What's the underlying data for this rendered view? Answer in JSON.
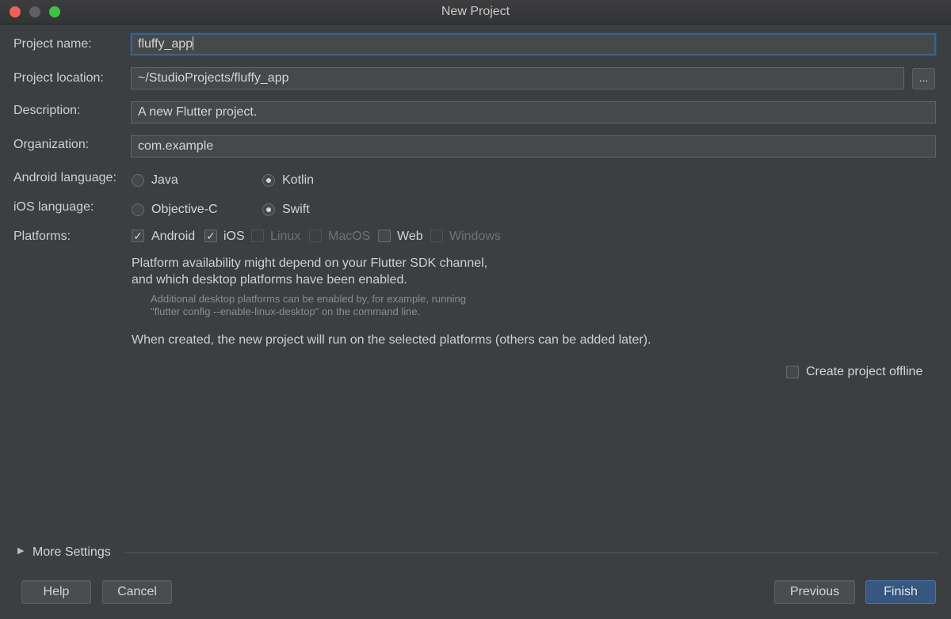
{
  "window": {
    "title": "New Project"
  },
  "form": {
    "project_name": {
      "label": "Project name:",
      "value": "fluffy_app"
    },
    "project_location": {
      "label": "Project location:",
      "value": "~/StudioProjects/fluffy_app",
      "browse_label": "..."
    },
    "description": {
      "label": "Description:",
      "value": "A new Flutter project."
    },
    "organization": {
      "label": "Organization:",
      "value": "com.example"
    },
    "android_language": {
      "label": "Android language:",
      "options": [
        "Java",
        "Kotlin"
      ],
      "selected": "Kotlin"
    },
    "ios_language": {
      "label": "iOS language:",
      "options": [
        "Objective-C",
        "Swift"
      ],
      "selected": "Swift"
    },
    "platforms": {
      "label": "Platforms:",
      "items": [
        {
          "label": "Android",
          "checked": true,
          "enabled": true
        },
        {
          "label": "iOS",
          "checked": true,
          "enabled": true
        },
        {
          "label": "Linux",
          "checked": false,
          "enabled": false
        },
        {
          "label": "MacOS",
          "checked": false,
          "enabled": false
        },
        {
          "label": "Web",
          "checked": false,
          "enabled": true
        },
        {
          "label": "Windows",
          "checked": false,
          "enabled": false
        }
      ]
    },
    "platform_note_line1": "Platform availability might depend on your Flutter SDK channel,",
    "platform_note_line2": "and which desktop platforms have been enabled.",
    "desktop_note_line1": "Additional desktop platforms can be enabled by, for example, running",
    "desktop_note_line2": "\"flutter config --enable-linux-desktop\" on the command line.",
    "created_note": "When created, the new project will run on the selected platforms (others can be added later).",
    "offline": {
      "label": "Create project offline",
      "checked": false
    }
  },
  "more_settings": {
    "label": "More Settings",
    "expanded": false
  },
  "buttons": {
    "help": "Help",
    "cancel": "Cancel",
    "previous": "Previous",
    "finish": "Finish"
  },
  "colors": {
    "background": "#3c3f41",
    "field": "#45494a",
    "focus": "#3d6185",
    "primary_button": "#365880"
  }
}
